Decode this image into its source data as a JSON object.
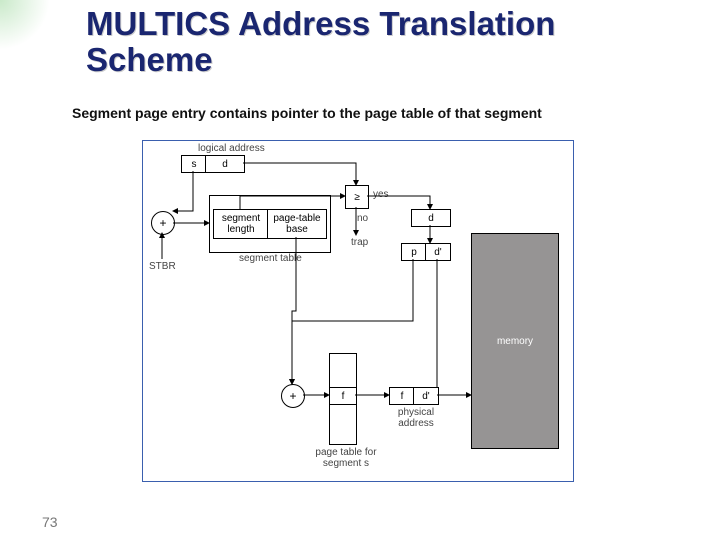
{
  "title_line1": "MULTICS Address Translation",
  "title_line2": "Scheme",
  "subtitle": "Segment page entry contains pointer to the page table of that segment",
  "page_number": "73",
  "diagram": {
    "logical_address": "logical address",
    "s": "s",
    "d": "d",
    "yes": "yes",
    "no": "no",
    "cmp": "≥",
    "trap": "trap",
    "seg_len": "segment\nlength",
    "pt_base": "page-table\nbase",
    "seg_table": "segment table",
    "stbr": "STBR",
    "p": "p",
    "dprime": "d'",
    "f": "f",
    "f2": "f",
    "d2": "d'",
    "phys_addr": "physical\naddress",
    "page_table_for": "page table for\nsegment s",
    "memory": "memory",
    "plus": "+"
  }
}
